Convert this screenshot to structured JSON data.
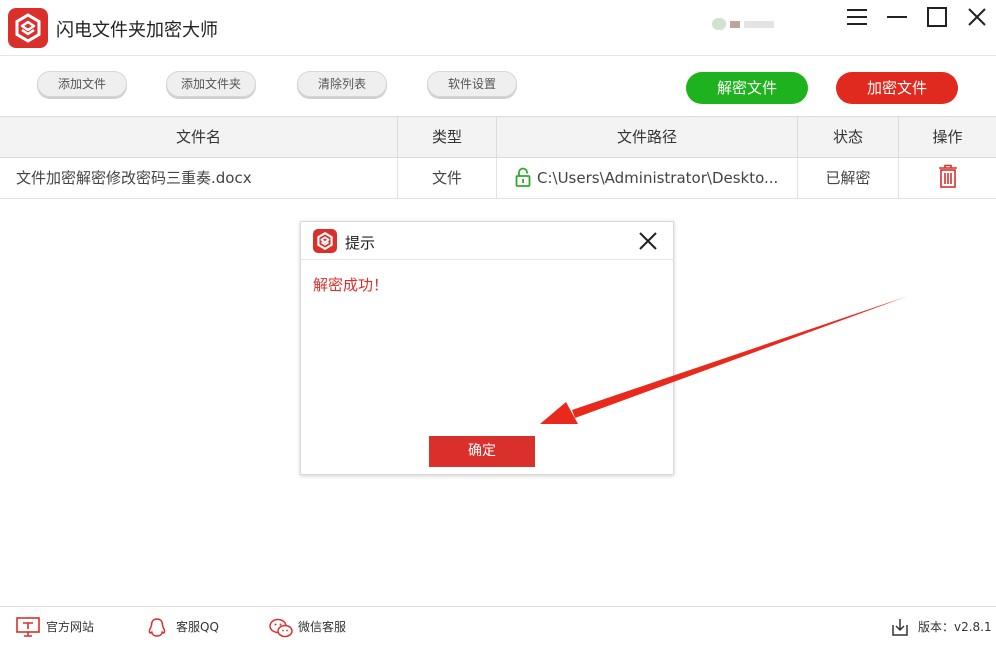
{
  "app": {
    "title": "闪电文件夹加密大师",
    "accent_color": "#d9302c",
    "decrypt_color": "#1fb21f"
  },
  "window_controls": [
    "menu-icon",
    "minimize-icon",
    "maximize-icon",
    "close-icon"
  ],
  "toolbar": {
    "add_file": "添加文件",
    "add_folder": "添加文件夹",
    "clear_list": "清除列表",
    "settings": "软件设置",
    "decrypt": "解密文件",
    "encrypt": "加密文件"
  },
  "table": {
    "headers": [
      "文件名",
      "类型",
      "文件路径",
      "状态",
      "操作"
    ],
    "rows": [
      {
        "name": "文件加密解密修改密码三重奏.docx",
        "type": "文件",
        "path": "C:\\Users\\Administrator\\Deskto...",
        "status": "已解密",
        "action_icon": "trash-icon"
      }
    ]
  },
  "dialog": {
    "title": "提示",
    "message": "解密成功！",
    "ok": "确定"
  },
  "footer": {
    "website": "官方网站",
    "qq": "客服QQ",
    "wechat": "微信客服",
    "version": "版本：v2.8.1"
  }
}
